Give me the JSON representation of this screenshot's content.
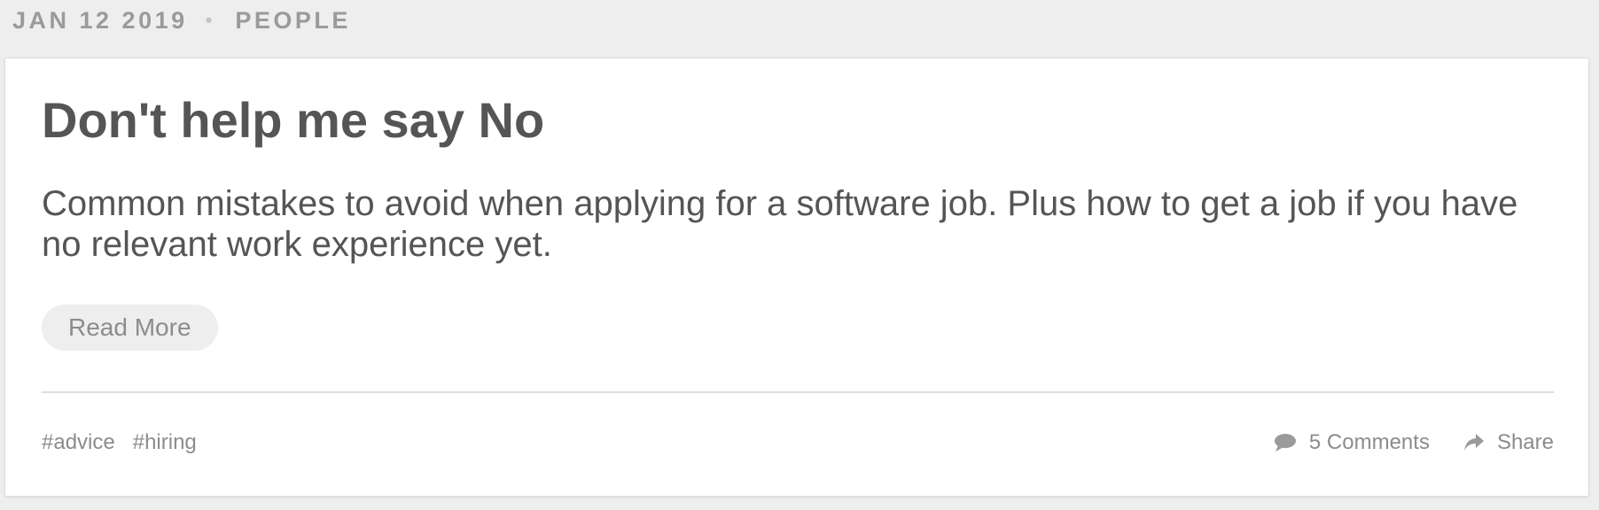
{
  "meta": {
    "date": "JAN 12 2019",
    "separator": "•",
    "category": "PEOPLE"
  },
  "post": {
    "title": "Don't help me say No",
    "summary": "Common mistakes to avoid when applying for a software job. Plus how to get a job if you have no relevant work experience yet.",
    "read_more_label": "Read More",
    "tags": [
      "#advice",
      "#hiring"
    ],
    "comments_label": "5 Comments",
    "share_label": "Share"
  },
  "icons": {
    "comments": "comment-bubble-icon",
    "share": "share-arrow-icon"
  },
  "colors": {
    "page_background": "#eeeeee",
    "card_background": "#ffffff",
    "text": "#555555",
    "muted_text": "#8c8c8c",
    "button_background": "#eeeeee"
  }
}
